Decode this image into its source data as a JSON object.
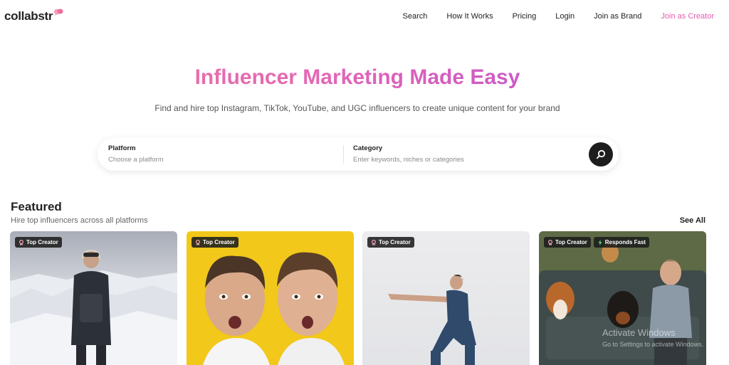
{
  "header": {
    "logo": "collabstr",
    "nav": [
      "Search",
      "How It Works",
      "Pricing",
      "Login",
      "Join as Brand",
      "Join as Creator"
    ]
  },
  "hero": {
    "title": "Influencer Marketing Made Easy",
    "subtitle": "Find and hire top Instagram, TikTok, YouTube, and UGC influencers to create unique content for your brand"
  },
  "search": {
    "platform_label": "Platform",
    "platform_placeholder": "Choose a platform",
    "category_label": "Category",
    "category_placeholder": "Enter keywords, niches or categories"
  },
  "featured": {
    "title": "Featured",
    "subtitle": "Hire top influencers across all platforms",
    "see_all": "See All",
    "cards": [
      {
        "badges": [
          "Top Creator"
        ]
      },
      {
        "badges": [
          "Top Creator"
        ]
      },
      {
        "badges": [
          "Top Creator"
        ]
      },
      {
        "badges": [
          "Top Creator",
          "Responds Fast"
        ]
      }
    ]
  },
  "watermark": {
    "line1": "Activate Windows",
    "line2": "Go to Settings to activate Windows."
  },
  "colors": {
    "accent": "#e05fae",
    "gradient_start": "#f07a9b",
    "gradient_end": "#b64dd8"
  }
}
